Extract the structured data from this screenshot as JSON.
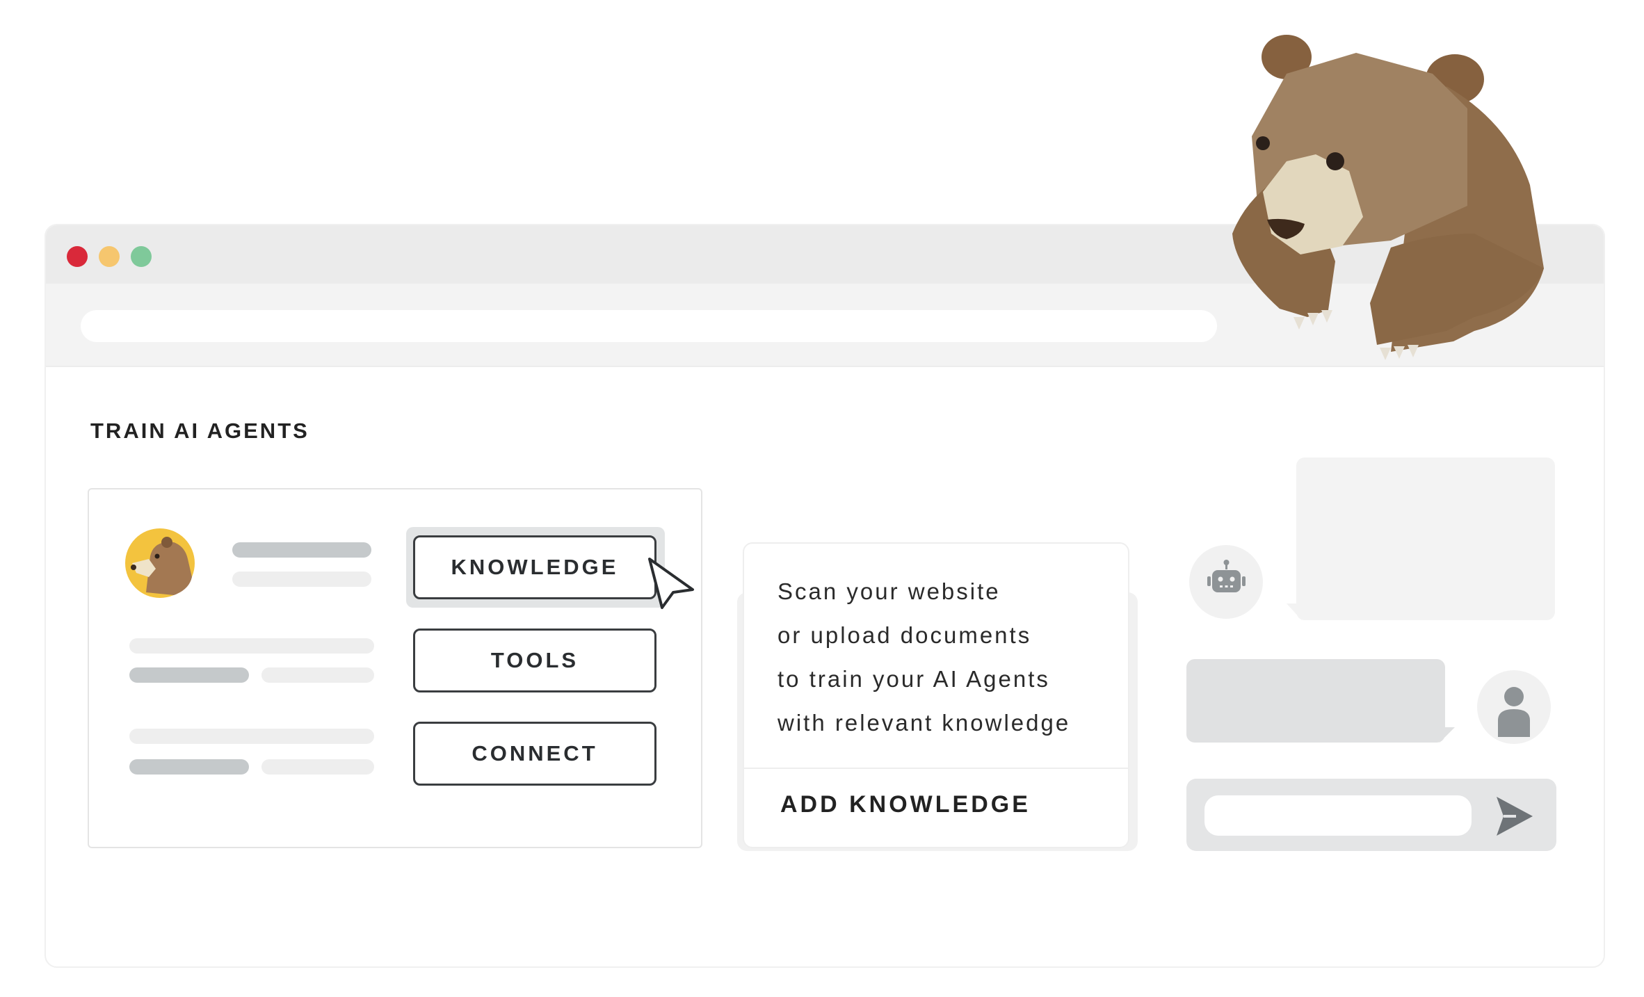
{
  "window": {
    "controls": [
      "close",
      "minimize",
      "maximize"
    ],
    "url": ""
  },
  "page": {
    "title": "TRAIN AI AGENTS"
  },
  "sidebar_card": {
    "avatar_icon": "bear-avatar-icon",
    "buttons": {
      "knowledge": "KNOWLEDGE",
      "tools": "TOOLS",
      "connect": "CONNECT"
    },
    "active_button": "KNOWLEDGE",
    "cursor_icon": "pointer-cursor-icon"
  },
  "info_card": {
    "lines": [
      "Scan your website",
      "or upload documents",
      "to train your AI Agents",
      "with relevant knowledge"
    ],
    "action": "ADD KNOWLEDGE"
  },
  "chat": {
    "bot_icon": "robot-icon",
    "user_icon": "user-icon",
    "input_value": "",
    "send_icon": "send-icon"
  },
  "mascot": "bear-illustration",
  "colors": {
    "close": "#d9293a",
    "minimize": "#f6c66e",
    "maximize": "#7fc99a",
    "bear_brown": "#9d7f5e",
    "avatar_yellow": "#f3c33e"
  }
}
